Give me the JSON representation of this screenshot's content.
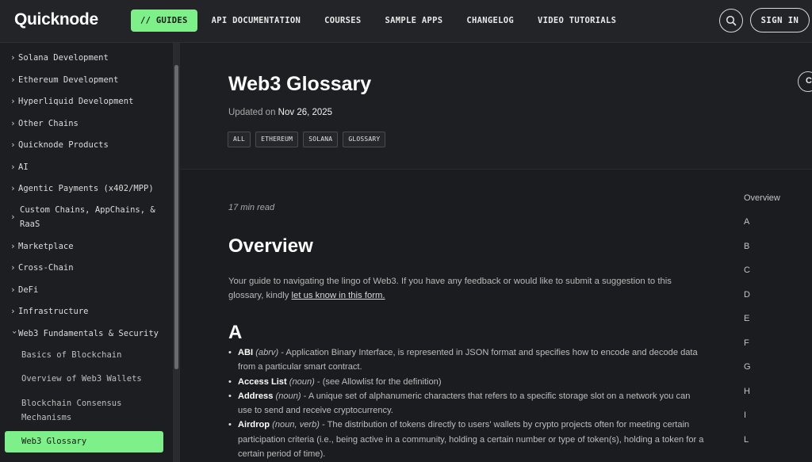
{
  "brand": {
    "logo_text": "Quicknode"
  },
  "nav": {
    "items": [
      "// GUIDES",
      "API DOCUMENTATION",
      "COURSES",
      "SAMPLE APPS",
      "CHANGELOG",
      "VIDEO TUTORIALS"
    ],
    "signin_label": "SIGN IN"
  },
  "sidebar": {
    "items": [
      "Solana Development",
      "Ethereum Development",
      "Hyperliquid Development",
      "Other Chains",
      "Quicknode Products",
      "AI",
      "Agentic Payments (x402/MPP)",
      "Custom Chains, AppChains, & RaaS",
      "Marketplace",
      "Cross-Chain",
      "DeFi",
      "Infrastructure",
      "Web3 Fundamentals & Security"
    ],
    "subitems": [
      "Basics of Blockchain",
      "Overview of Web3 Wallets",
      "Blockchain Consensus Mechanisms"
    ],
    "active": "Web3 Glossary"
  },
  "article": {
    "title": "Web3 Glossary",
    "updated_prefix": "Updated on",
    "updated_date": "Nov 26, 2025",
    "tags": [
      "ALL",
      "ETHEREUM",
      "SOLANA",
      "GLOSSARY"
    ],
    "read_time": "17 min read",
    "overview_heading": "Overview",
    "intro_text": "Your guide to navigating the lingo of Web3. If you have any feedback or would like to submit a suggestion to this glossary, kindly",
    "intro_link": "let us know in this form.",
    "section_a": "A",
    "terms": [
      {
        "term": "ABI",
        "pos": "(abrv)",
        "def": " - Application Binary Interface, is represented in JSON format and specifies how to encode and decode data from a particular smart contract."
      },
      {
        "term": "Access List",
        "pos": "(noun)",
        "def": " - (see Allowlist for the definition)"
      },
      {
        "term": "Address",
        "pos": "(noun)",
        "def": " - A unique set of alphanumeric characters that refers to a specific storage slot on a network you can use to send and receive cryptocurrency."
      },
      {
        "term": "Airdrop",
        "pos": "(noun, verb)",
        "def": " - The distribution of tokens directly to users' wallets by crypto projects often for meeting certain participation criteria (i.e., being active in a community, holding a certain number or type of token(s), holding a token for a certain period of time)."
      }
    ]
  },
  "toc": {
    "items": [
      "Overview",
      "A",
      "B",
      "C",
      "D",
      "E",
      "F",
      "G",
      "H",
      "I",
      "L"
    ]
  },
  "corner_label": "C"
}
